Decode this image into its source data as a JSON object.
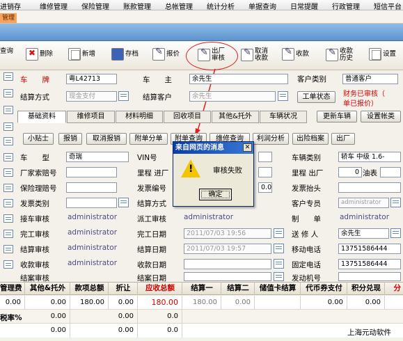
{
  "menu": [
    "进销存",
    "维修管理",
    "保险管理",
    "账款管理",
    "总帐管理",
    "统计分析",
    "单据查询",
    "日常提醒",
    "行政管理",
    "短信平台"
  ],
  "subtab": {
    "label": "管理"
  },
  "toolbar": {
    "query": "查询",
    "delete": "删除",
    "new": "新增",
    "save": "存档",
    "quote": "报价",
    "out_line1": "出厂",
    "out_line2": "审核",
    "cancel_line1": "取消",
    "cancel_line2": "收款",
    "collect": "收款",
    "hist_line1": "收款",
    "hist_line2": "历史",
    "settings": "设置"
  },
  "form1": {
    "plate_label": "车　　牌",
    "plate_value": "粤L42713",
    "car_label": "车　　主",
    "car_value": "余先生",
    "custtype_label": "客户类别",
    "custtype_value": "普通客户",
    "settle_label": "结算方式",
    "settle_value": "现金支付",
    "settlecust_label": "结算客户",
    "settlecust_value": "余先生",
    "workstatus_button": "工单状态",
    "finance_note_line1": "财务已审核（",
    "finance_note_line2": "单已报价）"
  },
  "tabs": [
    "基础资料",
    "维修项目",
    "材料明细",
    "回收项目",
    "其他&托外",
    "车辆状况",
    "更新车辆",
    "设置帐类"
  ],
  "actions": [
    "小贴士",
    "报销",
    "取消报销",
    "附单分单",
    "附单查询",
    "维修查询",
    "利润分析",
    "出险档案",
    "出厂"
  ],
  "details": {
    "model_label": "车　　型",
    "model_value": "奇瑞",
    "vin_label": "VIN号",
    "vehclass_label": "车辆类别",
    "vehclass_value": "轿车 中级 1.6-",
    "factory_label": "厂家索赔号",
    "mileage_in_label": "里程 进厂",
    "mileage_out_label": "里程 出厂",
    "mileage_out_value": "0",
    "fuel_label": "油表",
    "insurance_label": "保险理赔号",
    "invoice_no_label": "发票编号",
    "invoice_amount_value": "0.00",
    "invoice_head_label": "发票抬头",
    "invoice_type_label": "发票类别",
    "settle2_label": "结算方式",
    "customer_rep_label": "客户专员",
    "customer_rep_value": "administrator",
    "receive_label": "接车审核",
    "receive_value": "administrator",
    "dispatch_label": "派工审核",
    "dispatch_value": "administrator",
    "maker_label": "制　　单",
    "maker_value": "administrator",
    "finish_label": "完工审核",
    "finish_value": "administrator",
    "finish_date_label": "完工日期",
    "finish_date_value": "2011/07/03 19:56",
    "sender_label": "送 修 人",
    "sender_value": "余先生",
    "settle_audit_label": "结算审核",
    "settle_audit_value": "administrator",
    "settle_date_label": "结算日期",
    "settle_date_value": "2011/07/03 19:57",
    "mobile_label": "移动电话",
    "mobile_value": "13751586444",
    "collect_audit_label": "收款审核",
    "collect_audit_value": "administrator",
    "collect_date_label": "收款日期",
    "phone_label": "固定电话",
    "phone_value": "13751586444",
    "archive_label": "结案审核",
    "archive_date_label": "结案日期",
    "engine_label": "发动机号"
  },
  "summary": {
    "headers": [
      "管理费",
      "其他&托外",
      "款项总额",
      "折让",
      "应收总额",
      "结算一",
      "结算二",
      "储值卡结算",
      "代币券支付",
      "积分兑现",
      "分"
    ],
    "row1": [
      "0.00",
      "0.00",
      "180.00",
      "0.00",
      "180.00",
      "180.00",
      "0.00",
      "",
      "0.00",
      "0.00"
    ],
    "rate_label": "税率%",
    "row2": [
      "0.00",
      "",
      "",
      "0.00",
      "",
      "0.0"
    ],
    "row3": [
      "0.00",
      "",
      "",
      "0.00",
      "",
      "0.0"
    ]
  },
  "dialog": {
    "title": "来自网页的消息",
    "close": "✕",
    "icon": "warning-icon",
    "message": "审核失败",
    "ok": "确定"
  },
  "watermark": "上海元动软件",
  "colors": {
    "accent_blue": "#5d93cf",
    "warning_red": "#d40000",
    "dialog_title": "#0a3ea8"
  }
}
